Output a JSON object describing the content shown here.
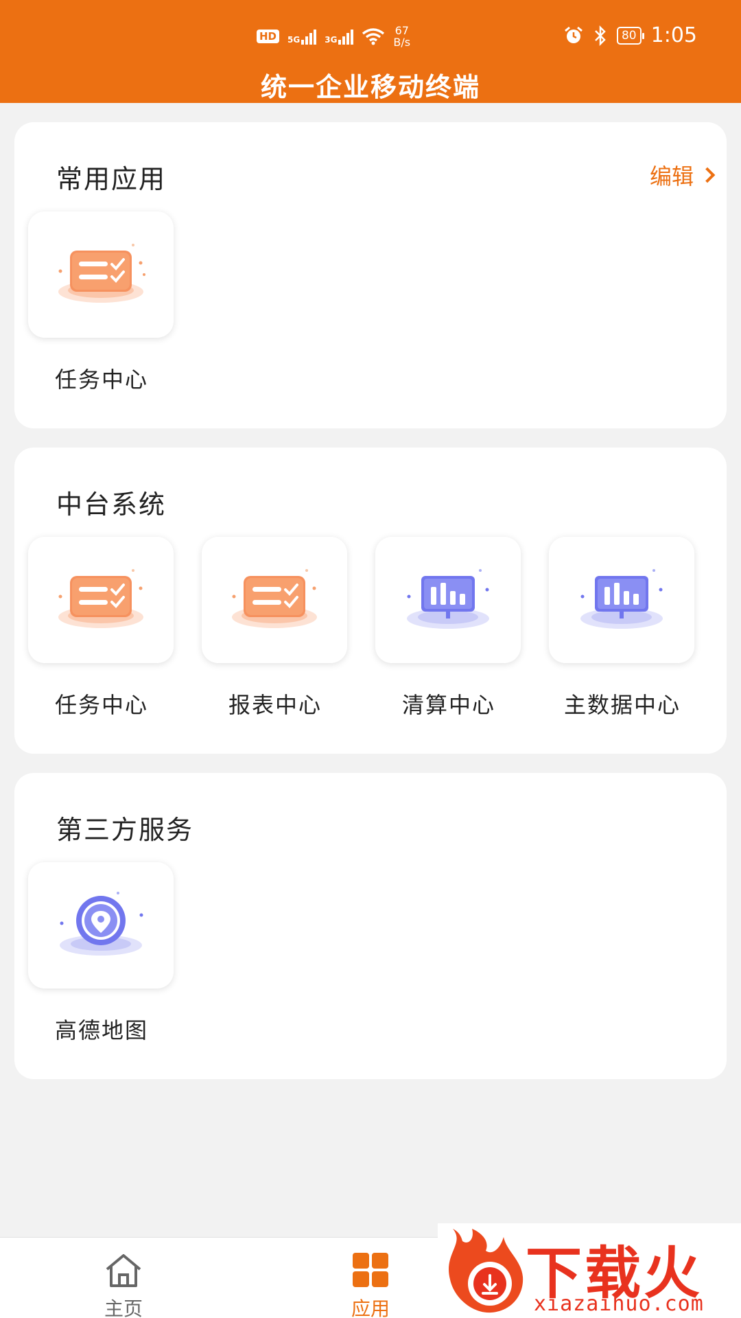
{
  "status_bar": {
    "hd": "HD",
    "sig1": "5G",
    "sig2": "3G",
    "speed_value": "67",
    "speed_unit": "B/s",
    "battery": "80",
    "time": "1:05"
  },
  "header": {
    "title": "统一企业移动终端"
  },
  "sections": {
    "common": {
      "title": "常用应用",
      "edit_label": "编辑",
      "apps": [
        {
          "label": "任务中心",
          "icon": "task-icon"
        }
      ]
    },
    "platform": {
      "title": "中台系统",
      "apps": [
        {
          "label": "任务中心",
          "icon": "task-icon"
        },
        {
          "label": "报表中心",
          "icon": "task-icon"
        },
        {
          "label": "清算中心",
          "icon": "chart-monitor-icon"
        },
        {
          "label": "主数据中心",
          "icon": "chart-monitor-icon"
        }
      ]
    },
    "third_party": {
      "title": "第三方服务",
      "apps": [
        {
          "label": "高德地图",
          "icon": "map-pin-icon"
        }
      ]
    }
  },
  "tabs": [
    {
      "label": "主页",
      "icon": "home-icon",
      "active": false
    },
    {
      "label": "应用",
      "icon": "grid-icon",
      "active": true
    }
  ],
  "watermark": {
    "brand": "下载火",
    "site": "xiazaihuo.com"
  },
  "colors": {
    "accent": "#ec7012",
    "inactive": "#666666",
    "watermark": "#e8321e"
  }
}
